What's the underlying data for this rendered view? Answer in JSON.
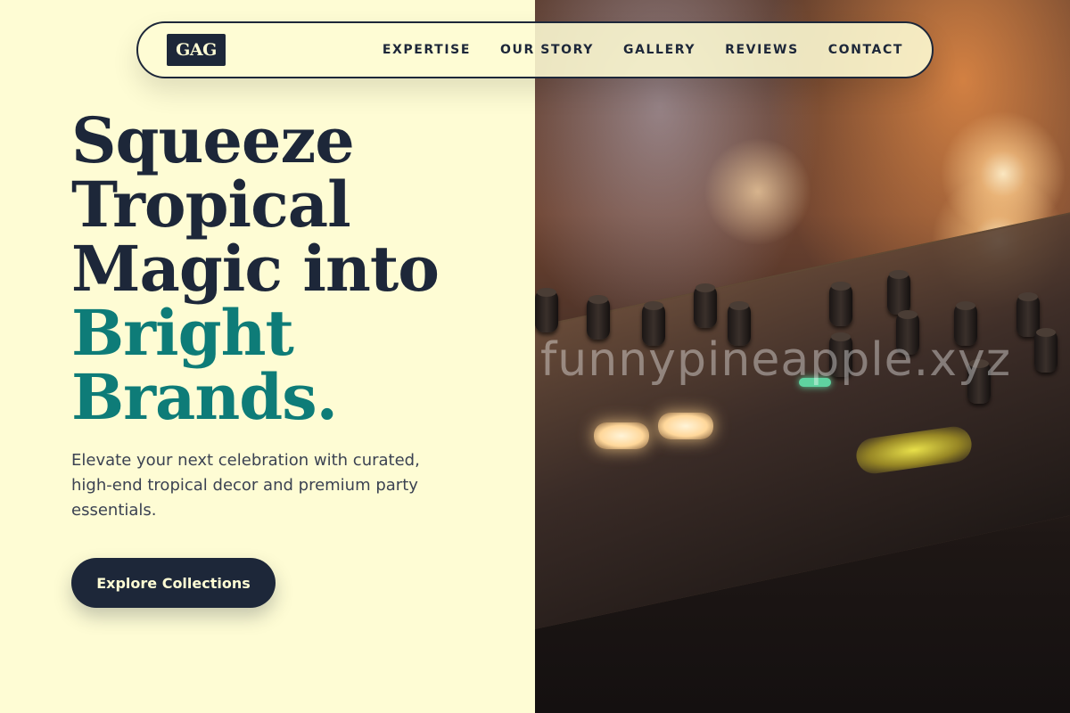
{
  "brand": {
    "logo_text": "GAG"
  },
  "nav": {
    "items": [
      {
        "label": "EXPERTISE"
      },
      {
        "label": "OUR STORY"
      },
      {
        "label": "GALLERY"
      },
      {
        "label": "REVIEWS"
      },
      {
        "label": "CONTACT"
      }
    ]
  },
  "hero": {
    "title_lines": [
      "Squeeze",
      "Tropical",
      "Magic into"
    ],
    "title_accent_lines": [
      "Bright",
      "Brands."
    ],
    "subtitle": "Elevate your next celebration with curated, high-end tropical decor and premium party essentials.",
    "cta_label": "Explore Collections"
  },
  "image": {
    "subject": "dj-mixer-console",
    "watermark": "funnypineapple.xyz"
  },
  "colors": {
    "background": "#fefcd4",
    "navy": "#1d2739",
    "teal_accent": "#0e7c78",
    "body_text": "#3b4252"
  }
}
